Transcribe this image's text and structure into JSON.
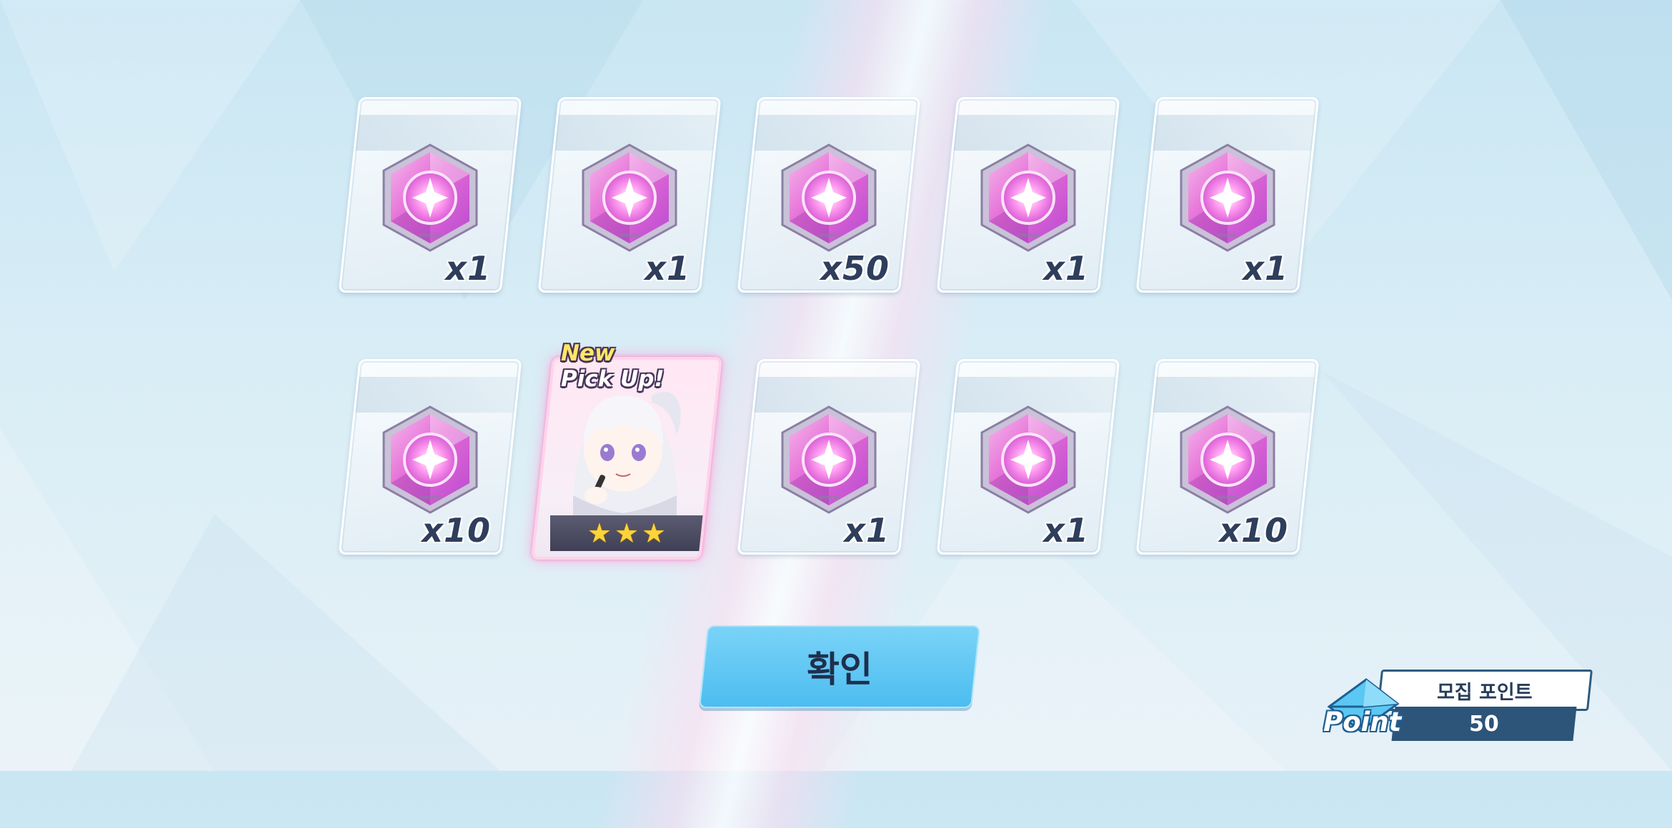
{
  "results": [
    {
      "type": "gem",
      "quantity": "x1",
      "icon": "pink-crystal-icon"
    },
    {
      "type": "gem",
      "quantity": "x1",
      "icon": "pink-crystal-icon"
    },
    {
      "type": "gem",
      "quantity": "x50",
      "icon": "pink-crystal-icon"
    },
    {
      "type": "gem",
      "quantity": "x1",
      "icon": "pink-crystal-icon"
    },
    {
      "type": "gem",
      "quantity": "x1",
      "icon": "pink-crystal-icon"
    },
    {
      "type": "gem",
      "quantity": "x10",
      "icon": "pink-crystal-icon"
    },
    {
      "type": "character",
      "badge_line1": "New",
      "badge_line2": "Pick Up!",
      "stars": 3,
      "star_glyph": "★",
      "portrait": "white-haired-girl-portrait"
    },
    {
      "type": "gem",
      "quantity": "x1",
      "icon": "pink-crystal-icon"
    },
    {
      "type": "gem",
      "quantity": "x1",
      "icon": "pink-crystal-icon"
    },
    {
      "type": "gem",
      "quantity": "x10",
      "icon": "pink-crystal-icon"
    }
  ],
  "confirm_button": {
    "label": "확인"
  },
  "recruit_points": {
    "title": "모집 포인트",
    "value": "50",
    "badge_word": "Point",
    "icon": "envelope-point-icon"
  },
  "colors": {
    "accent": "#4cbdf0",
    "points_dark": "#2d5479",
    "gem_pink": "#e46ad6",
    "star": "#ffd43a"
  }
}
